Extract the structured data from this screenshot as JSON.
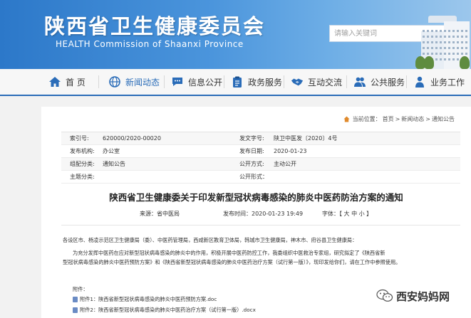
{
  "header": {
    "site_title": "陕西省卫生健康委员会",
    "site_subtitle": "HEALTH Commission of Shaanxi Province",
    "search": {
      "placeholder": "请输入关键词"
    }
  },
  "nav": {
    "items": [
      {
        "label": "首 页",
        "icon": "home-icon"
      },
      {
        "label": "新闻动态",
        "icon": "globe-icon",
        "active": true
      },
      {
        "label": "信息公开",
        "icon": "chat-icon"
      },
      {
        "label": "政务服务",
        "icon": "clipboard-icon"
      },
      {
        "label": "互动交流",
        "icon": "handshake-icon"
      },
      {
        "label": "公共服务",
        "icon": "people-icon"
      },
      {
        "label": "业务工作",
        "icon": "person-icon"
      }
    ]
  },
  "breadcrumb": {
    "prefix": "当前位置：",
    "items": [
      "首页",
      "新闻动态",
      "通知公告"
    ],
    "separator": ">"
  },
  "meta": {
    "rows": [
      {
        "l_label": "索引号:",
        "l_value": "620000/2020-00020",
        "r_label": "发文字号:",
        "r_value": "陕卫中医发〔2020〕4号"
      },
      {
        "l_label": "发布机构:",
        "l_value": "办公室",
        "r_label": "发布日期:",
        "r_value": "2020-01-23"
      },
      {
        "l_label": "组配分类:",
        "l_value": "通知公告",
        "r_label": "公开方式:",
        "r_value": "主动公开"
      },
      {
        "l_label": "主题分类:",
        "l_value": "",
        "r_label": "公开形式：",
        "r_value": ""
      }
    ]
  },
  "article": {
    "title": "陕西省卫生健康委关于印发新型冠状病毒感染的肺炎中医药防治方案的通知",
    "source": "来源：省中医局",
    "publish_time": "发布时间：2020-01-23 19:49",
    "font_size": "字体：【 大 中 小 】",
    "recipients": "各设区市、杨凌示范区卫生健康局（委）、中医药管理局，西咸新区教育卫体局，韩城市卫生健康局，神木市、府谷县卫生健康局：",
    "para_line1": "为充分发挥中医药在应对新型冠状病毒感染的肺炎中的作用，积极开展中医药防控工作，我委组织中医救治专家组，研究拟定了《陕西省新",
    "para_line2": "型冠状病毒感染的肺炎中医药预防方案》和《陕西省新型冠状病毒感染的肺炎中医药治疗方案（试行第一版）》，现印发给你们，请在工作中参照使用。",
    "attach_label": "附件：",
    "attachments": [
      "附件1：陕西省新型冠状病毒感染的肺炎中医药预防方案.doc",
      "附件2：陕西省新型冠状病毒感染的肺炎中医药治疗方案（试行第一版）.docx"
    ]
  },
  "watermark": {
    "text": "西安妈妈网"
  }
}
